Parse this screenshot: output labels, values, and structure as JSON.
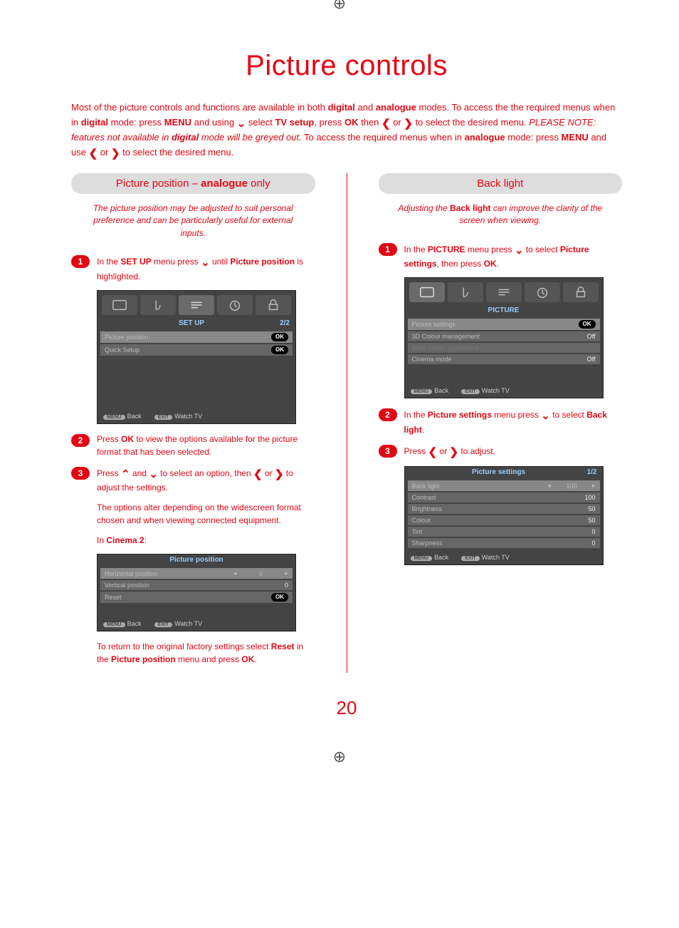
{
  "title": "Picture controls",
  "intro_parts": {
    "a": "Most of the picture controls and functions are available in both ",
    "b": "digital",
    "c": " and ",
    "d": "analogue",
    "e": " modes. To access the the required menus when in ",
    "f": "digital",
    "g": " mode: press ",
    "h": "MENU",
    "i": " and using ",
    "j": " select ",
    "k": "TV setup",
    "l": ", press ",
    "m": "OK",
    "n": " then ",
    "o": " or ",
    "p": " to select the desired menu. ",
    "note": "PLEASE NOTE: features not available in ",
    "note_b": "digital",
    "note_c": " mode will be greyed out.",
    "q": " To access the required menus when in ",
    "r": "analogue",
    "s": " mode: press ",
    "t": "MENU",
    "u": " and use ",
    "v": " or ",
    "w": " to select the desired menu."
  },
  "left": {
    "head_a": "Picture position – ",
    "head_b": "analogue",
    "head_c": " only",
    "lead": "The picture position may be adjusted to suit personal preference and can be particularly useful for external inputs.",
    "step1_a": "In the ",
    "step1_b": "SET UP",
    "step1_c": " menu press ",
    "step1_d": " until ",
    "step1_e": "Picture position",
    "step1_f": " is highlighted.",
    "osd1": {
      "title": "SET UP",
      "page": "2/2",
      "rows": [
        {
          "label": "Picture position",
          "val": "OK",
          "sel": true
        },
        {
          "label": "Quick Setup",
          "val": "OK"
        }
      ],
      "foot_back": "Back",
      "foot_watch": "Watch TV",
      "menu_pill": "MENU",
      "exit_pill": "EXIT"
    },
    "step2_a": "Press ",
    "step2_b": "OK",
    "step2_c": " to view the options available for the picture format that has been selected.",
    "step3_a": "Press ",
    "step3_b": " and ",
    "step3_c": " to select an option, then ",
    "step3_d": " or ",
    "step3_e": " to adjust the settings.",
    "body1": "The options alter depending on the widescreen format chosen and when viewing connected equipment.",
    "body2_a": "In ",
    "body2_b": "Cinema 2",
    "body2_c": ":",
    "osd2": {
      "title": "Picture position",
      "rows": [
        {
          "label": "Horizontal position",
          "val": "0",
          "sel": true,
          "slider": true
        },
        {
          "label": "Vertical position",
          "val": "0"
        },
        {
          "label": "Reset",
          "val": "OK"
        }
      ],
      "foot_back": "Back",
      "foot_watch": "Watch TV",
      "menu_pill": "MENU",
      "exit_pill": "EXIT"
    },
    "tail_a": "To return to the original factory settings select ",
    "tail_b": "Reset",
    "tail_c": " in the ",
    "tail_d": "Picture position",
    "tail_e": " menu and press ",
    "tail_f": "OK",
    "tail_g": "."
  },
  "right": {
    "head": "Back light",
    "lead_a": "Adjusting the ",
    "lead_b": "Back light",
    "lead_c": " can improve the clarity of the screen when viewing.",
    "step1_a": "In the ",
    "step1_b": "PICTURE",
    "step1_c": " menu press ",
    "step1_d": " to select ",
    "step1_e": "Picture settings",
    "step1_f": ", then press ",
    "step1_g": "OK",
    "step1_h": ".",
    "osd1": {
      "title": "PICTURE",
      "rows": [
        {
          "label": "Picture settings",
          "val": "OK",
          "sel": true
        },
        {
          "label": "3D Colour management",
          "val": "Off"
        },
        {
          "label": "Base colour adjustment",
          "val": "",
          "disabled": true
        },
        {
          "label": "Cinema mode",
          "val": "Off"
        }
      ],
      "foot_back": "Back",
      "foot_watch": "Watch TV",
      "menu_pill": "MENU",
      "exit_pill": "EXIT"
    },
    "step2_a": "In the ",
    "step2_b": "Picture settings",
    "step2_c": " menu press ",
    "step2_d": " to select ",
    "step2_e": "Back light",
    "step2_f": ".",
    "step3_a": "Press ",
    "step3_b": " or ",
    "step3_c": " to adjust.",
    "osd2": {
      "title": "Picture settings",
      "page": "1/2",
      "rows": [
        {
          "label": "Back light",
          "val": "100",
          "sel": true,
          "slider": true
        },
        {
          "label": "Contrast",
          "val": "100"
        },
        {
          "label": "Brightness",
          "val": "50"
        },
        {
          "label": "Colour",
          "val": "50"
        },
        {
          "label": "Tint",
          "val": "0"
        },
        {
          "label": "Sharpness",
          "val": "0"
        }
      ],
      "foot_back": "Back",
      "foot_watch": "Watch TV",
      "menu_pill": "MENU",
      "exit_pill": "EXIT"
    }
  },
  "page_number": "20"
}
